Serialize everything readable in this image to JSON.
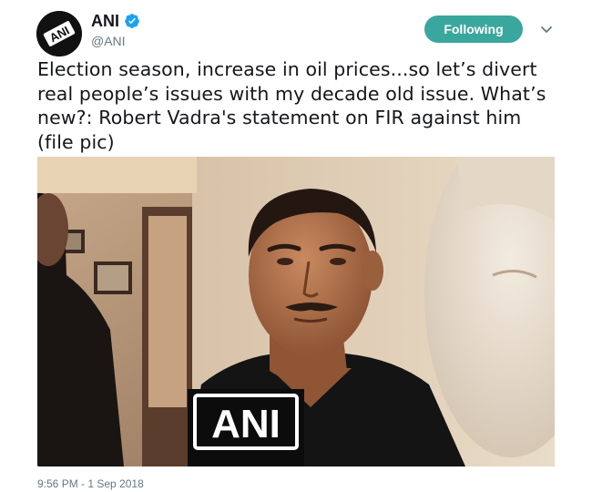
{
  "author": {
    "display_name": "ANI",
    "handle": "@ANI",
    "avatar_text": "ANI",
    "verified_icon": "verified-badge-icon"
  },
  "actions": {
    "follow_label": "Following",
    "menu_icon": "chevron-down-icon"
  },
  "tweet": {
    "text": "Election season, increase in oil prices...so let’s divert real people’s issues with my decade old issue. What’s new?: Robert Vadra's statement on FIR against him (file pic)",
    "media": {
      "mic_logo_text": "ANI"
    },
    "timestamp": "9:56 PM - 1 Sep 2018"
  },
  "colors": {
    "follow_button": "#3aa79e",
    "verified": "#1da1f2",
    "muted_text": "#657786"
  }
}
